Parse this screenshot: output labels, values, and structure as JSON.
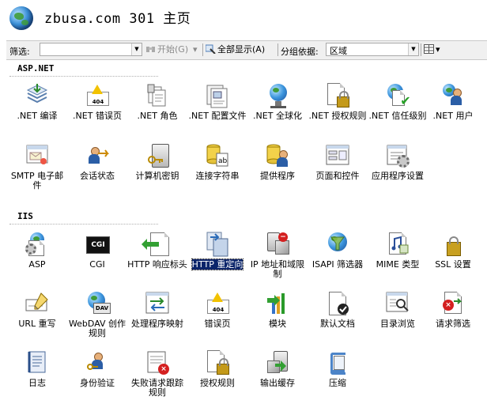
{
  "header": {
    "title": "zbusa.com 301 主页",
    "icon": "globe-icon"
  },
  "toolbar": {
    "filter_label": "筛选:",
    "filter_value": "",
    "start_label": "开始(G)",
    "showall_label": "全部显示(A)",
    "groupby_label": "分组依据:",
    "groupby_value": "区域"
  },
  "sections": [
    {
      "title": "ASP.NET",
      "items": [
        {
          "label": ".NET 编译",
          "icon": "net-compilation-icon"
        },
        {
          "label": ".NET 错误页",
          "icon": "net-error-pages-icon"
        },
        {
          "label": ".NET 角色",
          "icon": "net-roles-icon"
        },
        {
          "label": ".NET 配置文件",
          "icon": "net-profile-icon"
        },
        {
          "label": ".NET 全球化",
          "icon": "net-globalization-icon"
        },
        {
          "label": ".NET 授权规则",
          "icon": "net-authorization-rules-icon"
        },
        {
          "label": ".NET 信任级别",
          "icon": "net-trust-levels-icon"
        },
        {
          "label": ".NET 用户",
          "icon": "net-users-icon"
        },
        {
          "label": "SMTP 电子邮件",
          "icon": "smtp-email-icon"
        },
        {
          "label": "会话状态",
          "icon": "session-state-icon"
        },
        {
          "label": "计算机密钥",
          "icon": "machine-key-icon"
        },
        {
          "label": "连接字符串",
          "icon": "connection-strings-icon"
        },
        {
          "label": "提供程序",
          "icon": "providers-icon"
        },
        {
          "label": "页面和控件",
          "icon": "pages-controls-icon"
        },
        {
          "label": "应用程序设置",
          "icon": "app-settings-icon"
        }
      ]
    },
    {
      "title": "IIS",
      "items": [
        {
          "label": "ASP",
          "icon": "asp-icon"
        },
        {
          "label": "CGI",
          "icon": "cgi-icon"
        },
        {
          "label": "HTTP 响应标头",
          "icon": "http-response-headers-icon"
        },
        {
          "label": "HTTP 重定向",
          "icon": "http-redirect-icon",
          "selected": true
        },
        {
          "label": "IP 地址和域限制",
          "icon": "ip-domain-restrictions-icon"
        },
        {
          "label": "ISAPI 筛选器",
          "icon": "isapi-filters-icon"
        },
        {
          "label": "MIME 类型",
          "icon": "mime-types-icon"
        },
        {
          "label": "SSL 设置",
          "icon": "ssl-settings-icon"
        },
        {
          "label": "URL 重写",
          "icon": "url-rewrite-icon"
        },
        {
          "label": "WebDAV 创作规则",
          "icon": "webdav-authoring-rules-icon"
        },
        {
          "label": "处理程序映射",
          "icon": "handler-mappings-icon"
        },
        {
          "label": "错误页",
          "icon": "error-pages-icon"
        },
        {
          "label": "模块",
          "icon": "modules-icon"
        },
        {
          "label": "默认文档",
          "icon": "default-document-icon"
        },
        {
          "label": "目录浏览",
          "icon": "directory-browsing-icon"
        },
        {
          "label": "请求筛选",
          "icon": "request-filtering-icon"
        },
        {
          "label": "日志",
          "icon": "logging-icon"
        },
        {
          "label": "身份验证",
          "icon": "authentication-icon"
        },
        {
          "label": "失败请求跟踪规则",
          "icon": "failed-request-tracing-icon"
        },
        {
          "label": "授权规则",
          "icon": "authorization-rules-icon"
        },
        {
          "label": "输出缓存",
          "icon": "output-caching-icon"
        },
        {
          "label": "压缩",
          "icon": "compression-icon"
        }
      ]
    }
  ]
}
